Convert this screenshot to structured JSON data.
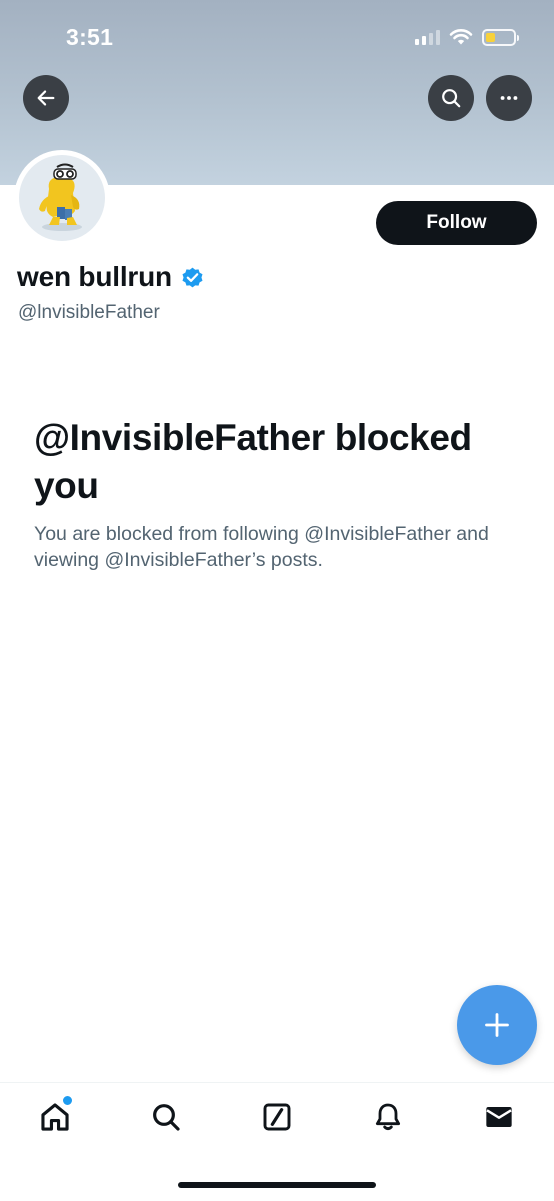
{
  "status_bar": {
    "time": "3:51",
    "battery_level": 0.35,
    "battery_color": "#f7d13b"
  },
  "header": {
    "back_icon": "arrow-left-icon",
    "search_icon": "search-icon",
    "more_icon": "more-horizontal-icon",
    "banner_color": "#b3c2d0"
  },
  "profile": {
    "display_name": "wen bullrun",
    "verified_icon": "verified-badge-icon",
    "verified_color": "#1d9bf0",
    "handle": "@lnvisibleFather",
    "follow_label": "Follow"
  },
  "blocked": {
    "title": "@InvisibleFather blocked you",
    "description": "You are blocked from following @InvisibleFather and viewing @InvisibleFather’s posts."
  },
  "fab": {
    "icon": "plus-icon",
    "color": "#4a99e9"
  },
  "tab_bar": {
    "items": [
      {
        "name": "home",
        "icon": "home-icon",
        "notification_dot": true
      },
      {
        "name": "search",
        "icon": "search-icon"
      },
      {
        "name": "grok",
        "icon": "slash-square-icon"
      },
      {
        "name": "notifications",
        "icon": "bell-icon"
      },
      {
        "name": "messages",
        "icon": "mail-icon"
      }
    ]
  }
}
